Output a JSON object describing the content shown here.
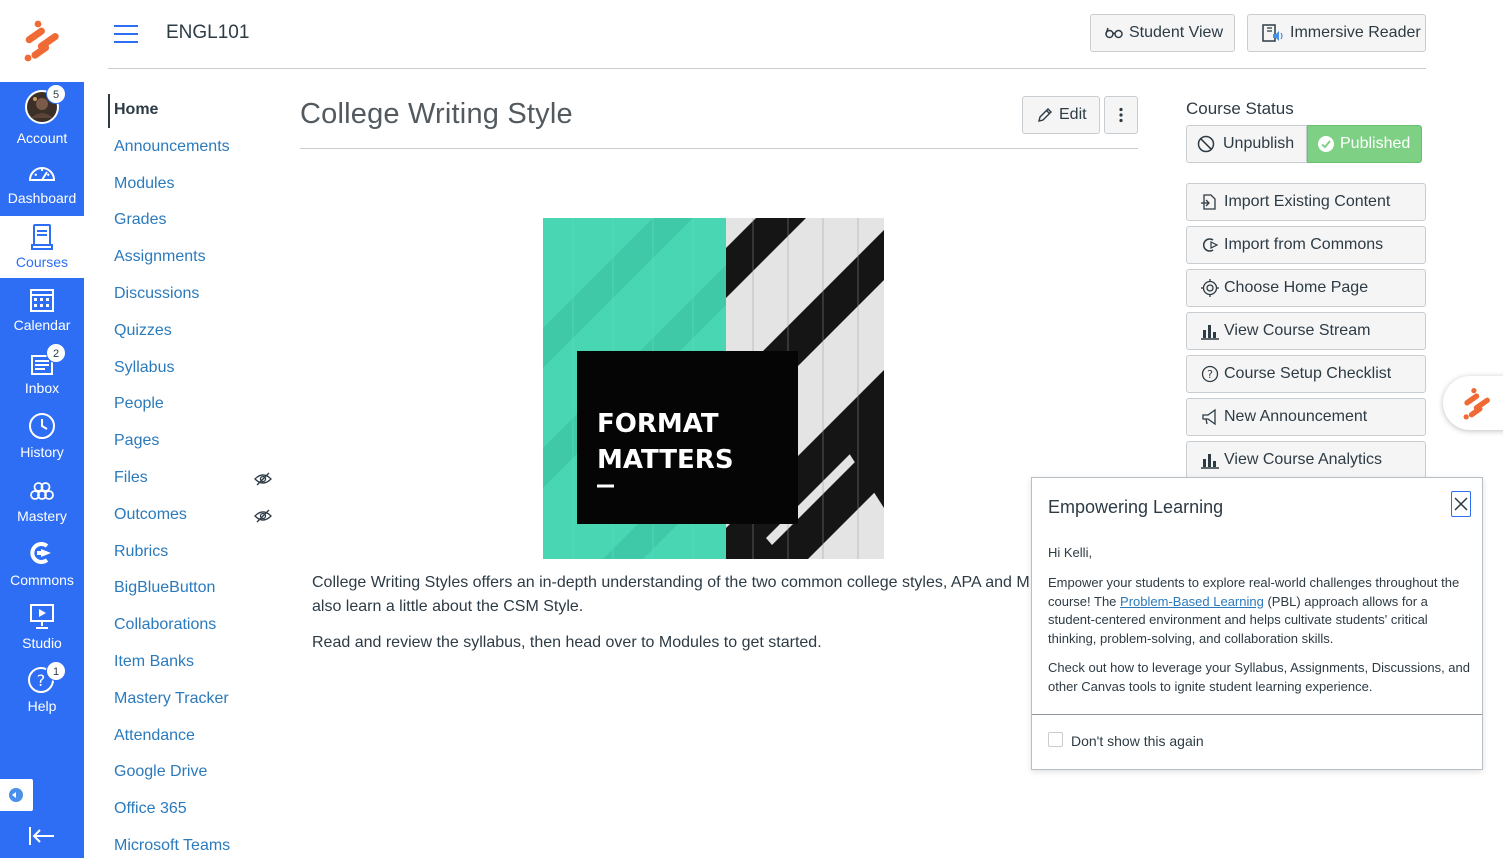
{
  "colors": {
    "brand_blue": "#2d6ef5",
    "link": "#2b7abc",
    "text": "#2d3b45",
    "published_green": "#7ed184",
    "logo_orange": "#f06a35"
  },
  "global_nav": [
    {
      "key": "account",
      "label": "Account",
      "icon": "avatar",
      "badge": "5"
    },
    {
      "key": "dashboard",
      "label": "Dashboard",
      "icon": "dashboard-icon"
    },
    {
      "key": "courses",
      "label": "Courses",
      "icon": "courses-icon",
      "active": true
    },
    {
      "key": "calendar",
      "label": "Calendar",
      "icon": "calendar-icon"
    },
    {
      "key": "inbox",
      "label": "Inbox",
      "icon": "inbox-icon",
      "badge": "2"
    },
    {
      "key": "history",
      "label": "History",
      "icon": "clock-icon"
    },
    {
      "key": "mastery",
      "label": "Mastery",
      "icon": "mastery-icon"
    },
    {
      "key": "commons",
      "label": "Commons",
      "icon": "commons-icon"
    },
    {
      "key": "studio",
      "label": "Studio",
      "icon": "studio-icon"
    },
    {
      "key": "help",
      "label": "Help",
      "icon": "help-icon",
      "badge": "1"
    }
  ],
  "header": {
    "course_code": "ENGL101",
    "student_view": "Student View",
    "immersive_reader": "Immersive Reader"
  },
  "course_nav": [
    {
      "label": "Home",
      "active": true
    },
    {
      "label": "Announcements"
    },
    {
      "label": "Modules"
    },
    {
      "label": "Grades"
    },
    {
      "label": "Assignments"
    },
    {
      "label": "Discussions"
    },
    {
      "label": "Quizzes"
    },
    {
      "label": "Syllabus"
    },
    {
      "label": "People"
    },
    {
      "label": "Pages"
    },
    {
      "label": "Files",
      "hidden": true
    },
    {
      "label": "Outcomes",
      "hidden": true
    },
    {
      "label": "Rubrics"
    },
    {
      "label": "BigBlueButton"
    },
    {
      "label": "Collaborations"
    },
    {
      "label": "Item Banks"
    },
    {
      "label": "Mastery Tracker"
    },
    {
      "label": "Attendance"
    },
    {
      "label": "Google Drive"
    },
    {
      "label": "Office 365"
    },
    {
      "label": "Microsoft Teams"
    }
  ],
  "main": {
    "title": "College Writing Style",
    "edit_label": "Edit",
    "hero": {
      "line1": "FORMAT",
      "line2": "MATTERS"
    },
    "paragraph1_line1": "College Writing Styles offers an in-depth understanding of the two common college styles, APA and ML",
    "paragraph1_line2": "also learn a little about the CSM Style.",
    "paragraph2": "Read and review the syllabus, then head over to Modules to get started."
  },
  "sidebar": {
    "status_heading": "Course Status",
    "unpublish": "Unpublish",
    "published": "Published",
    "actions": [
      {
        "label": "Import Existing Content",
        "icon": "import-icon"
      },
      {
        "label": "Import from Commons",
        "icon": "commons-icon"
      },
      {
        "label": "Choose Home Page",
        "icon": "target-icon"
      },
      {
        "label": "View Course Stream",
        "icon": "bar-chart-icon"
      },
      {
        "label": "Course Setup Checklist",
        "icon": "question-icon"
      },
      {
        "label": "New Announcement",
        "icon": "megaphone-icon"
      },
      {
        "label": "View Course Analytics",
        "icon": "bar-chart-icon"
      }
    ]
  },
  "modal": {
    "title": "Empowering Learning",
    "greeting": "Hi Kelli,",
    "p1_before": "Empower your students to explore real-world challenges throughout the course! The ",
    "p1_link": "Problem-Based Learning",
    "p1_after": " (PBL) approach allows for a student-centered environment and helps cultivate students' critical thinking, problem-solving, and collaboration skills.",
    "p2": "Check out how to leverage your Syllabus, Assignments, Discussions, and other Canvas tools to ignite student learning experience.",
    "checkbox_label": "Don't show this again"
  }
}
